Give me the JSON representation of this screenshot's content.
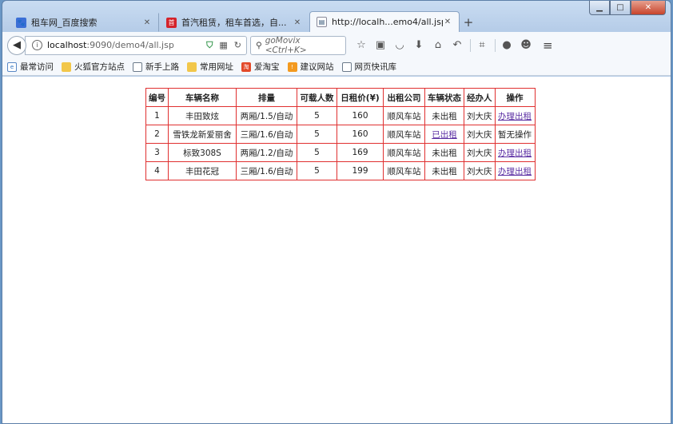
{
  "browser": {
    "tabs": [
      {
        "title": "租车网_百度搜索",
        "active": false
      },
      {
        "title": "首汽租赁，租车首选，自...",
        "active": false
      },
      {
        "title": "http://localh...emo4/all.jsp",
        "active": true
      }
    ],
    "new_tab": "+",
    "window_controls": {
      "minimize": "▁",
      "maximize": "□",
      "close": "✕"
    },
    "url": {
      "host": "localhost",
      "rest": ":9090/demo4/all.jsp"
    },
    "search_placeholder": "goMovix <Ctrl+K>",
    "bookmarks": [
      {
        "label": "最常访问",
        "icon": "ie-icon"
      },
      {
        "label": "火狐官方站点",
        "icon": "folder-icon"
      },
      {
        "label": "新手上路",
        "icon": "globe-icon"
      },
      {
        "label": "常用网址",
        "icon": "folder-icon"
      },
      {
        "label": "爱淘宝",
        "icon": "taobao-icon"
      },
      {
        "label": "建议网站",
        "icon": "suggest-icon"
      },
      {
        "label": "网页快讯库",
        "icon": "globe-icon"
      }
    ]
  },
  "table": {
    "headers": [
      "编号",
      "车辆名称",
      "排量",
      "可载人数",
      "日租价(¥)",
      "出租公司",
      "车辆状态",
      "经办人",
      "操作"
    ],
    "rows": [
      {
        "id": "1",
        "name": "丰田致炫",
        "displacement": "两厢/1.5/自动",
        "seats": "5",
        "price": "160",
        "company": "顺风车站",
        "status": "未出租",
        "status_link": false,
        "agent": "刘大庆",
        "action": "办理出租",
        "action_link": true
      },
      {
        "id": "2",
        "name": "雪铁龙新爱丽舍",
        "displacement": "三厢/1.6/自动",
        "seats": "5",
        "price": "160",
        "company": "顺风车站",
        "status": "已出租",
        "status_link": true,
        "agent": "刘大庆",
        "action": "暂无操作",
        "action_link": false
      },
      {
        "id": "3",
        "name": "标致308S",
        "displacement": "两厢/1.2/自动",
        "seats": "5",
        "price": "169",
        "company": "顺风车站",
        "status": "未出租",
        "status_link": false,
        "agent": "刘大庆",
        "action": "办理出租",
        "action_link": true
      },
      {
        "id": "4",
        "name": "丰田花冠",
        "displacement": "三厢/1.6/自动",
        "seats": "5",
        "price": "199",
        "company": "顺风车站",
        "status": "未出租",
        "status_link": false,
        "agent": "刘大庆",
        "action": "办理出租",
        "action_link": true
      }
    ]
  }
}
